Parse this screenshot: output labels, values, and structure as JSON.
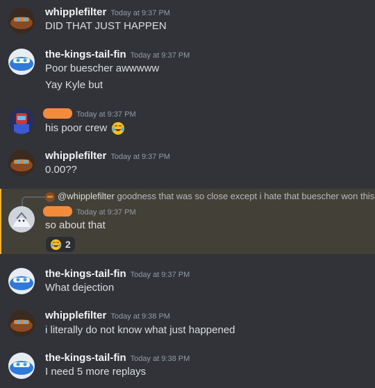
{
  "messages": [
    {
      "user": "whipplefilter",
      "time": "Today at 9:37 PM",
      "lines": [
        "DID THAT JUST HAPPEN"
      ],
      "avatar": "rusty-car-avatar"
    },
    {
      "user": "the-kings-tail-fin",
      "time": "Today at 9:37 PM",
      "lines": [
        "Poor buescher awwwww",
        "Yay Kyle but"
      ],
      "avatar": "blue-car-avatar"
    },
    {
      "user": "",
      "time": "Today at 9:37 PM",
      "lines": [
        "his poor crew"
      ],
      "emoji": "crying-laughing-emoji",
      "avatar": "robot-avatar"
    },
    {
      "user": "whipplefilter",
      "time": "Today at 9:37 PM",
      "lines": [
        "0.00??"
      ],
      "avatar": "rusty-car-avatar"
    },
    {
      "user": "",
      "time": "Today at 9:37 PM",
      "lines": [
        "so about that"
      ],
      "avatar": "white-creature-avatar",
      "reply": {
        "user": "@whipplefilter",
        "text": "goodness that was so close except i hate that buescher won this"
      },
      "reaction": {
        "emoji": "laughing-emoji",
        "count": "2"
      }
    },
    {
      "user": "the-kings-tail-fin",
      "time": "Today at 9:37 PM",
      "lines": [
        "What dejection"
      ],
      "avatar": "blue-car-avatar"
    },
    {
      "user": "whipplefilter",
      "time": "Today at 9:38 PM",
      "lines": [
        "i literally do not know what just happened"
      ],
      "avatar": "rusty-car-avatar"
    },
    {
      "user": "the-kings-tail-fin",
      "time": "Today at 9:38 PM",
      "lines": [
        "I need 5 more replays"
      ],
      "avatar": "blue-car-avatar"
    }
  ],
  "colors": {
    "background": "#313338",
    "highlight": "#434038",
    "redaction": "#f28b3c"
  }
}
